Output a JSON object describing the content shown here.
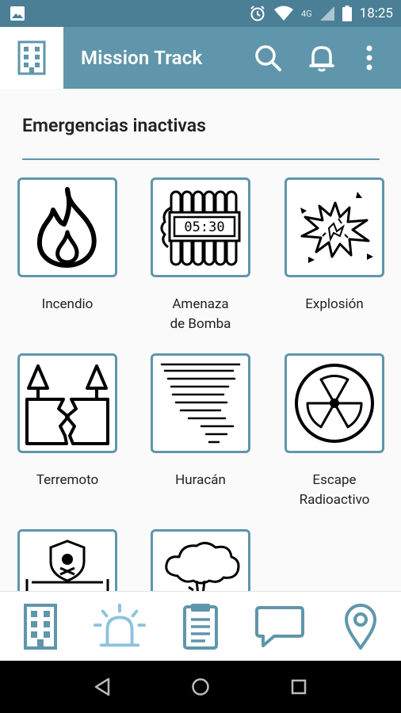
{
  "status_bar": {
    "time": "18:25",
    "network": "4G",
    "icons": [
      "image-icon",
      "alarm-icon",
      "wifi-icon",
      "signal-icon",
      "battery-icon"
    ]
  },
  "app_bar": {
    "title": "Mission Track",
    "logo_icon": "building-icon",
    "actions": [
      "search-icon",
      "bell-icon",
      "more-vert-icon"
    ]
  },
  "section": {
    "title": "Emergencias inactivas"
  },
  "emergencies": [
    {
      "label": "Incendio",
      "icon": "fire-icon"
    },
    {
      "label": "Amenaza\nde Bomba",
      "icon": "bomb-icon",
      "timer": "05:30"
    },
    {
      "label": "Explosión",
      "icon": "explosion-icon"
    },
    {
      "label": "Terremoto",
      "icon": "earthquake-icon"
    },
    {
      "label": "Huracán",
      "icon": "hurricane-icon"
    },
    {
      "label": "Escape\nRadioactivo",
      "icon": "radioactive-icon"
    },
    {
      "label": "",
      "icon": "toxic-spill-icon"
    },
    {
      "label": "",
      "icon": "tree-storm-icon"
    }
  ],
  "bottom_nav": [
    {
      "icon": "building-icon",
      "active": false
    },
    {
      "icon": "siren-icon",
      "active": true
    },
    {
      "icon": "clipboard-icon",
      "active": false
    },
    {
      "icon": "chat-icon",
      "active": false
    },
    {
      "icon": "location-pin-icon",
      "active": false
    }
  ],
  "colors": {
    "status_bar": "#4b7f96",
    "app_bar": "#5f96ac",
    "accent": "#5f96ac",
    "active_nav": "#8fc3dc"
  }
}
